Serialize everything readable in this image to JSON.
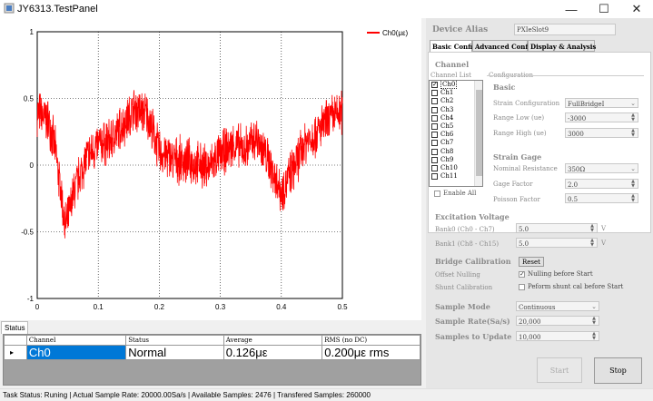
{
  "window": {
    "title": "JY6313.TestPanel"
  },
  "chart_data": {
    "type": "line",
    "series": [
      {
        "name": "Ch0(με)",
        "color": "#ff0000"
      }
    ],
    "xlim": [
      0,
      0.5
    ],
    "ylim": [
      -1,
      1
    ],
    "x_ticks": [
      "0",
      "0.1",
      "0.2",
      "0.3",
      "0.4",
      "0.5"
    ],
    "y_ticks": [
      "1",
      "0.5",
      "0",
      "-0.5",
      "-1"
    ],
    "grid": true,
    "legend": "top-right",
    "approx_envelope": {
      "x": [
        0,
        0.02,
        0.03,
        0.04,
        0.045,
        0.05,
        0.06,
        0.08,
        0.1,
        0.12,
        0.14,
        0.16,
        0.18,
        0.2,
        0.22,
        0.25,
        0.28,
        0.3,
        0.32,
        0.34,
        0.36,
        0.38,
        0.4,
        0.42,
        0.44,
        0.46,
        0.48,
        0.5
      ],
      "center": [
        0.4,
        0.32,
        0.1,
        -0.25,
        -0.45,
        -0.42,
        -0.2,
        0.05,
        0.15,
        0.18,
        0.3,
        0.42,
        0.38,
        0.1,
        0.05,
        0.02,
        -0.02,
        0.08,
        0.15,
        0.12,
        0.2,
        0.02,
        -0.2,
        -0.02,
        0.18,
        0.25,
        0.35,
        0.4
      ],
      "amplitude": 0.18
    }
  },
  "status_tab": "Status",
  "status_table": {
    "headers": [
      "Channel",
      "Status",
      "Average",
      "RMS (no DC)"
    ],
    "rows": [
      {
        "marker": "▸",
        "channel": "Ch0",
        "status": "Normal",
        "average": "0.126με",
        "rms": "0.200με rms"
      }
    ]
  },
  "statusbar": "Task Status: Runing  |  Actual Sample Rate: 20000.00Sa/s  |  Available Samples: 2476  |  Transfered Samples: 260000",
  "panel": {
    "device_alias_label": "Device Alias",
    "device_alias_value": "PXIeSlot9",
    "tabs": [
      "Basic Config",
      "Advanced Config",
      "Display & Analysis"
    ],
    "channel_header": "Channel",
    "channel_list_label": "Channel List",
    "channels": [
      "Ch0",
      "Ch1",
      "Ch2",
      "Ch3",
      "Ch4",
      "Ch5",
      "Ch6",
      "Ch7",
      "Ch8",
      "Ch9",
      "Ch10",
      "Ch11"
    ],
    "channel_checked": [
      true,
      false,
      false,
      false,
      false,
      false,
      false,
      false,
      false,
      false,
      false,
      false
    ],
    "enable_all": "Enable All",
    "configuration_label": "Configuration",
    "basic_header": "Basic",
    "strain_config_label": "Strain Configuration",
    "strain_config_value": "FullBridgeI",
    "range_low_label": "Range Low (ue)",
    "range_low_value": "-3000",
    "range_high_label": "Range High (ue)",
    "range_high_value": "3000",
    "strain_gage_header": "Strain Gage",
    "nominal_res_label": "Nominal Resistance",
    "nominal_res_value": "350Ω",
    "gage_factor_label": "Gage Factor",
    "gage_factor_value": "2.0",
    "poisson_label": "Poisson Factor",
    "poisson_value": "0.5",
    "excitation_header": "Excitation Voltage",
    "bank0_label": "Bank0 (Ch0 - Ch7)",
    "bank0_value": "5.0",
    "bank1_label": "Bank1 (Ch8 - Ch15)",
    "bank1_value": "5.0",
    "volt_unit": "V",
    "bridge_cal_header": "Bridge Calibration",
    "reset_label": "Reset",
    "offset_null_label": "Offset Nulling",
    "nulling_before_start": "Nulling before Start",
    "shunt_cal_label": "Shunt Calibration",
    "shunt_before_start": "Peform shunt cal before Start",
    "sample_mode_label": "Sample Mode",
    "sample_mode_value": "Continuous",
    "sample_rate_label": "Sample Rate(Sa/s)",
    "sample_rate_value": "20,000",
    "samples_update_label": "Samples to Update",
    "samples_update_value": "10,000",
    "start_label": "Start",
    "stop_label": "Stop"
  }
}
